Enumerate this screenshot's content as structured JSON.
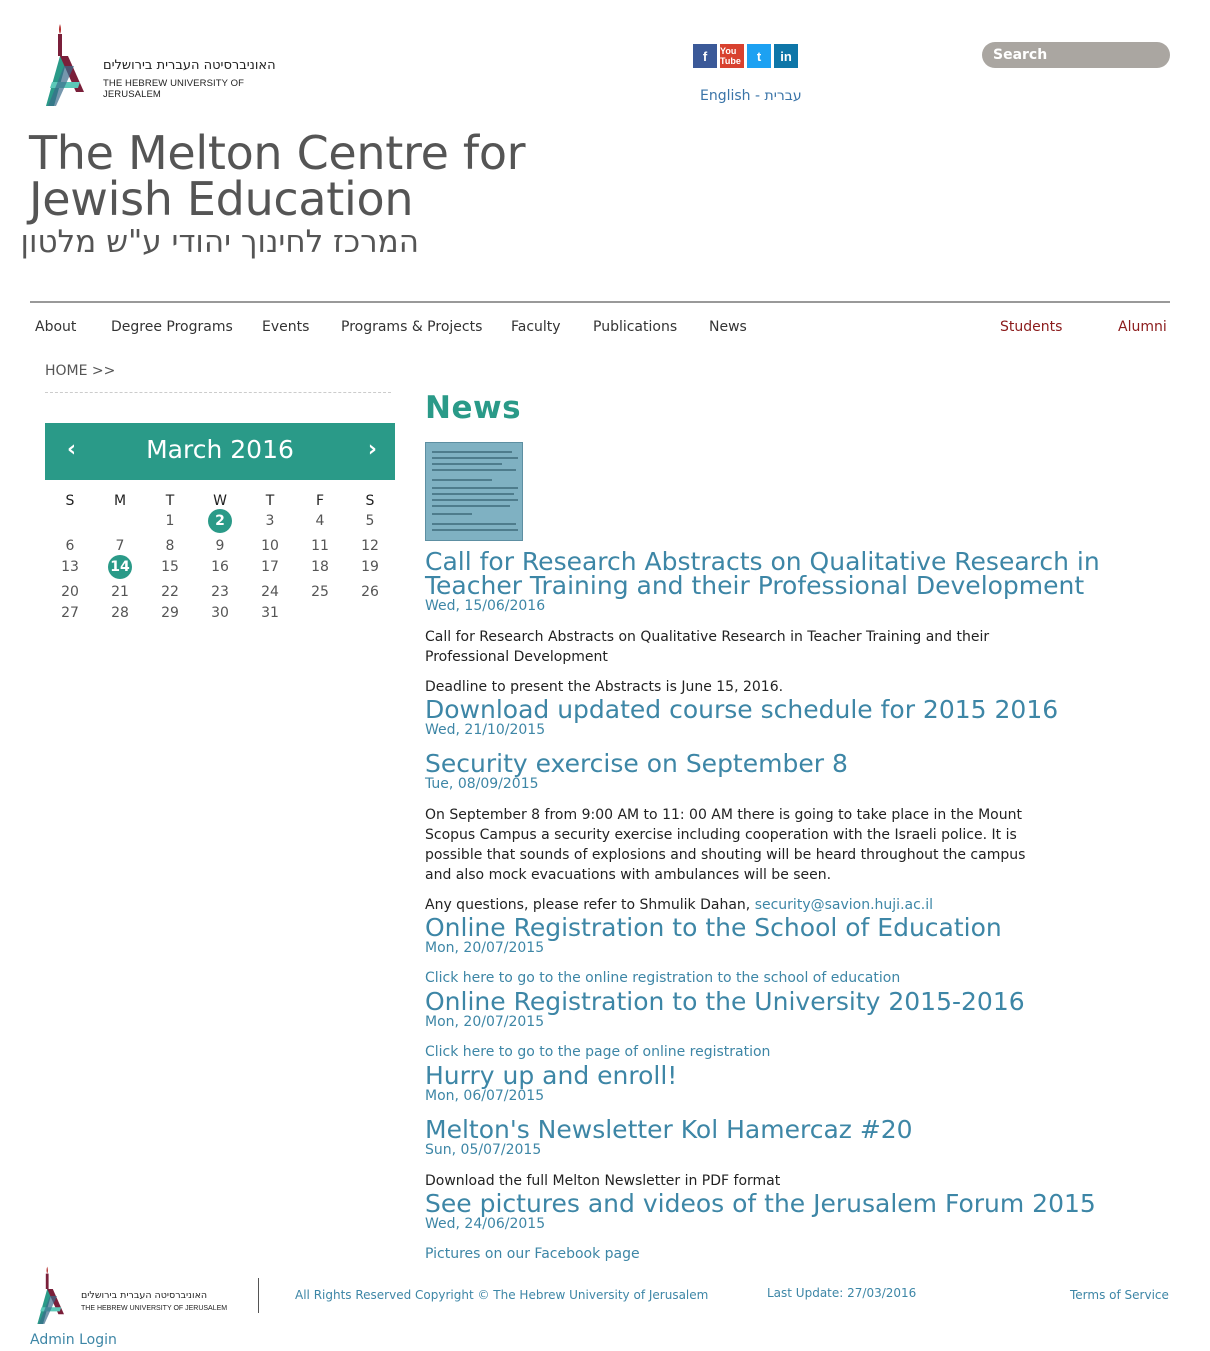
{
  "header": {
    "logo_he": "האוניברסיטה העברית בירושלים",
    "logo_en": "THE HEBREW UNIVERSITY OF JERUSALEM",
    "social": [
      "f",
      "You Tube",
      "t",
      "in"
    ],
    "lang_en": "English",
    "lang_sep": " - ",
    "lang_he": "עברית",
    "search_placeholder": "Search",
    "title_line1": "The Melton Centre for",
    "title_line2": "Jewish Education",
    "title_he": "המרכז לחינוך יהודי ע\"ש מלטון"
  },
  "nav": {
    "about": "About",
    "degree": "Degree Programs",
    "events": "Events",
    "programs": "Programs & Projects",
    "faculty": "Faculty",
    "publications": "Publications",
    "news": "News",
    "students": "Students",
    "alumni": "Alumni"
  },
  "breadcrumb": "HOME >>",
  "calendar": {
    "month": "March 2016",
    "prev": "‹",
    "next": "›",
    "weekdays": [
      "S",
      "M",
      "T",
      "W",
      "T",
      "F",
      "S"
    ],
    "highlighted": [
      2,
      14
    ]
  },
  "main": {
    "heading": "News",
    "items": [
      {
        "title1": "Call for Research Abstracts on Qualitative Research in",
        "title2": "Teacher Training and their Professional Development",
        "date": "Wed, 15/06/2016",
        "text1": "Call for Research Abstracts on Qualitative Research in Teacher Training and their Professional Development",
        "text2": "Deadline to present the Abstracts is June 15, 2016."
      },
      {
        "title": "Download updated course schedule for 2015 2016",
        "date": "Wed, 21/10/2015"
      },
      {
        "title": "Security exercise on September 8",
        "date": "Tue, 08/09/2015",
        "text1": "On September 8 from 9:00 AM to 11: 00 AM there is going to take place in the Mount Scopus Campus a security exercise including cooperation with the Israeli police. It is possible that sounds of explosions and shouting will be heard throughout the campus and also mock evacuations with ambulances will be seen.",
        "text2": "Any questions, please refer to Shmulik Dahan, ",
        "email": "security@savion.huji.ac.il"
      },
      {
        "title": "Online Registration to the School of Education",
        "date": "Mon, 20/07/2015",
        "link": "Click here to go to the online registration to the school of education"
      },
      {
        "title": "Online Registration to the University 2015-2016",
        "date": "Mon, 20/07/2015",
        "link": "Click here to go to the page of online registration"
      },
      {
        "title": "Hurry up and enroll!",
        "date": "Mon, 06/07/2015"
      },
      {
        "title": "Melton's Newsletter Kol Hamercaz #20",
        "date": "Sun, 05/07/2015",
        "text1": "Download the full Melton Newsletter in PDF format"
      },
      {
        "title": "See pictures and videos of the Jerusalem Forum 2015",
        "date": "Wed, 24/06/2015",
        "link": "Pictures on our Facebook page"
      }
    ]
  },
  "footer": {
    "logo_he": "האוניברסיטה העברית בירושלים",
    "logo_en": "THE HEBREW UNIVERSITY OF JERUSALEM",
    "copyright": "All Rights Reserved Copyright © The Hebrew University of Jerusalem",
    "last_update": "Last Update: 27/03/2016",
    "terms": "Terms of Service",
    "admin": "Admin Login"
  },
  "colors": {
    "accent": "#2a9a88",
    "link": "#3d86a6",
    "red_nav": "#8b1a1a"
  }
}
